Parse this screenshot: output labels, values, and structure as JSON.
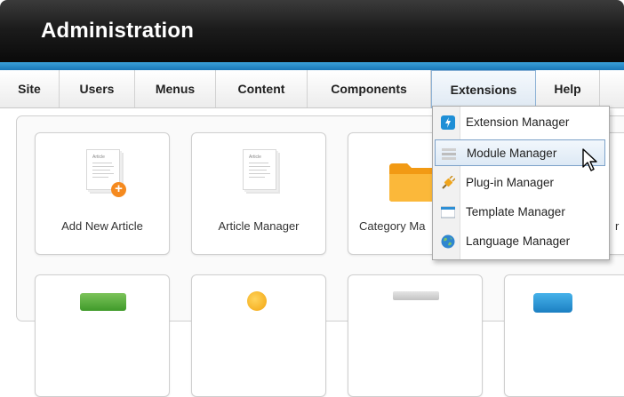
{
  "header": {
    "title": "Administration"
  },
  "menubar": {
    "items": [
      {
        "label": "Site"
      },
      {
        "label": "Users"
      },
      {
        "label": "Menus"
      },
      {
        "label": "Content"
      },
      {
        "label": "Components"
      },
      {
        "label": "Extensions"
      },
      {
        "label": "Help"
      }
    ],
    "active": "Extensions"
  },
  "dropdown": {
    "items": [
      {
        "label": "Extension Manager",
        "icon": "extension-icon"
      },
      {
        "label": "Module Manager",
        "icon": "module-icon"
      },
      {
        "label": "Plug-in Manager",
        "icon": "plugin-icon"
      },
      {
        "label": "Template Manager",
        "icon": "template-icon"
      },
      {
        "label": "Language Manager",
        "icon": "language-globe-icon"
      }
    ],
    "hovered": "Module Manager"
  },
  "cards": [
    {
      "label": "Add New Article",
      "icon": "add-article-icon",
      "doc_title": "Article"
    },
    {
      "label": "Article Manager",
      "icon": "article-manager-icon",
      "doc_title": "Article"
    },
    {
      "label": "Category Ma",
      "icon": "folder-icon"
    },
    {
      "label": "r",
      "icon": "media-icon"
    }
  ],
  "colors": {
    "header_bg": "#1c1c1c",
    "accent_blue": "#1a78b8",
    "badge_orange": "#f58a1f",
    "folder_orange": "#f7a21b",
    "hover_border": "#7da2c9"
  }
}
